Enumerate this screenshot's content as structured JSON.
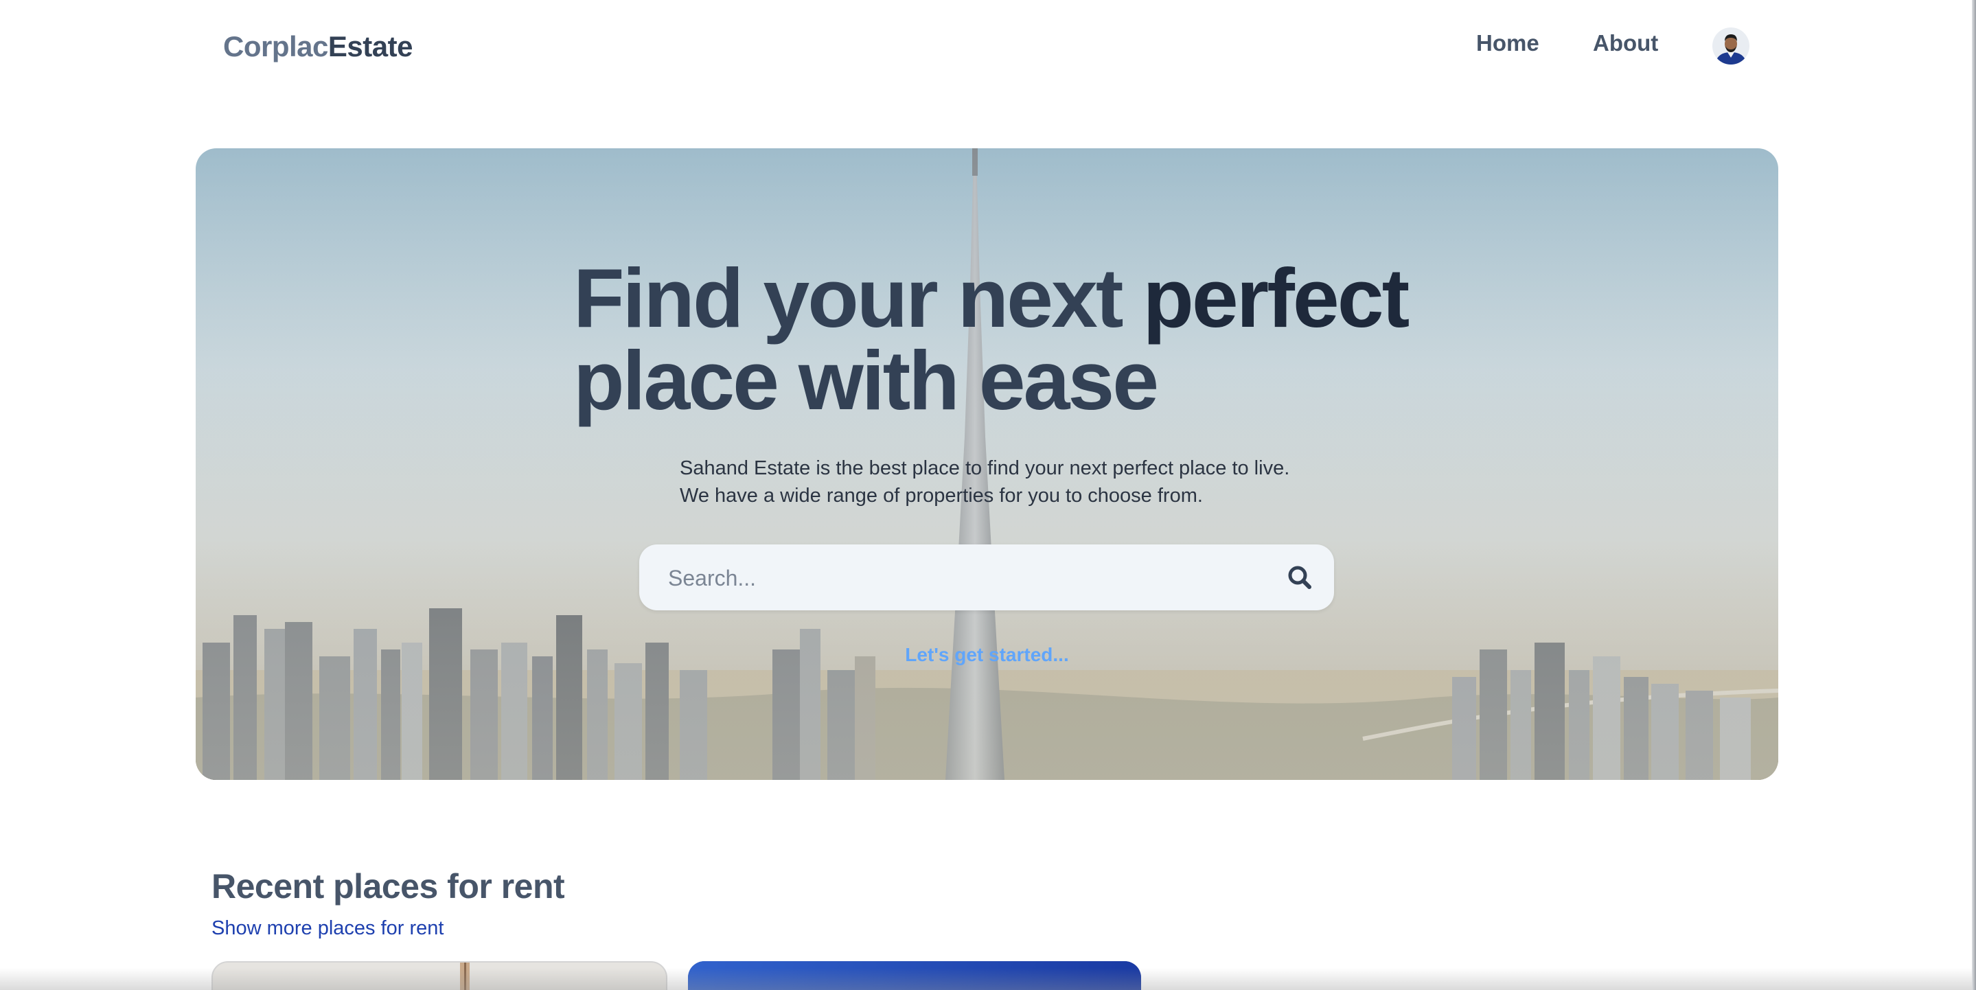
{
  "header": {
    "logo_part1": "Corplac",
    "logo_part2": "Estate",
    "nav": {
      "home": "Home",
      "about": "About"
    },
    "avatar_icon": "user-avatar"
  },
  "hero": {
    "title_part1": "Find your next",
    "title_part2": "perfect",
    "title_line2": "place with ease",
    "description_line1": "Sahand Estate is the best place to find your next perfect place to live.",
    "description_line2": "We have a wide range of properties for you to choose from.",
    "search": {
      "placeholder": "Search...",
      "icon": "search-icon"
    },
    "cta": "Let's get started..."
  },
  "recent": {
    "title": "Recent places for rent",
    "link": "Show more places for rent"
  },
  "colors": {
    "brand_light": "#64748b",
    "brand_dark": "#334155",
    "cta": "#60a5fa",
    "link": "#1e40af"
  }
}
